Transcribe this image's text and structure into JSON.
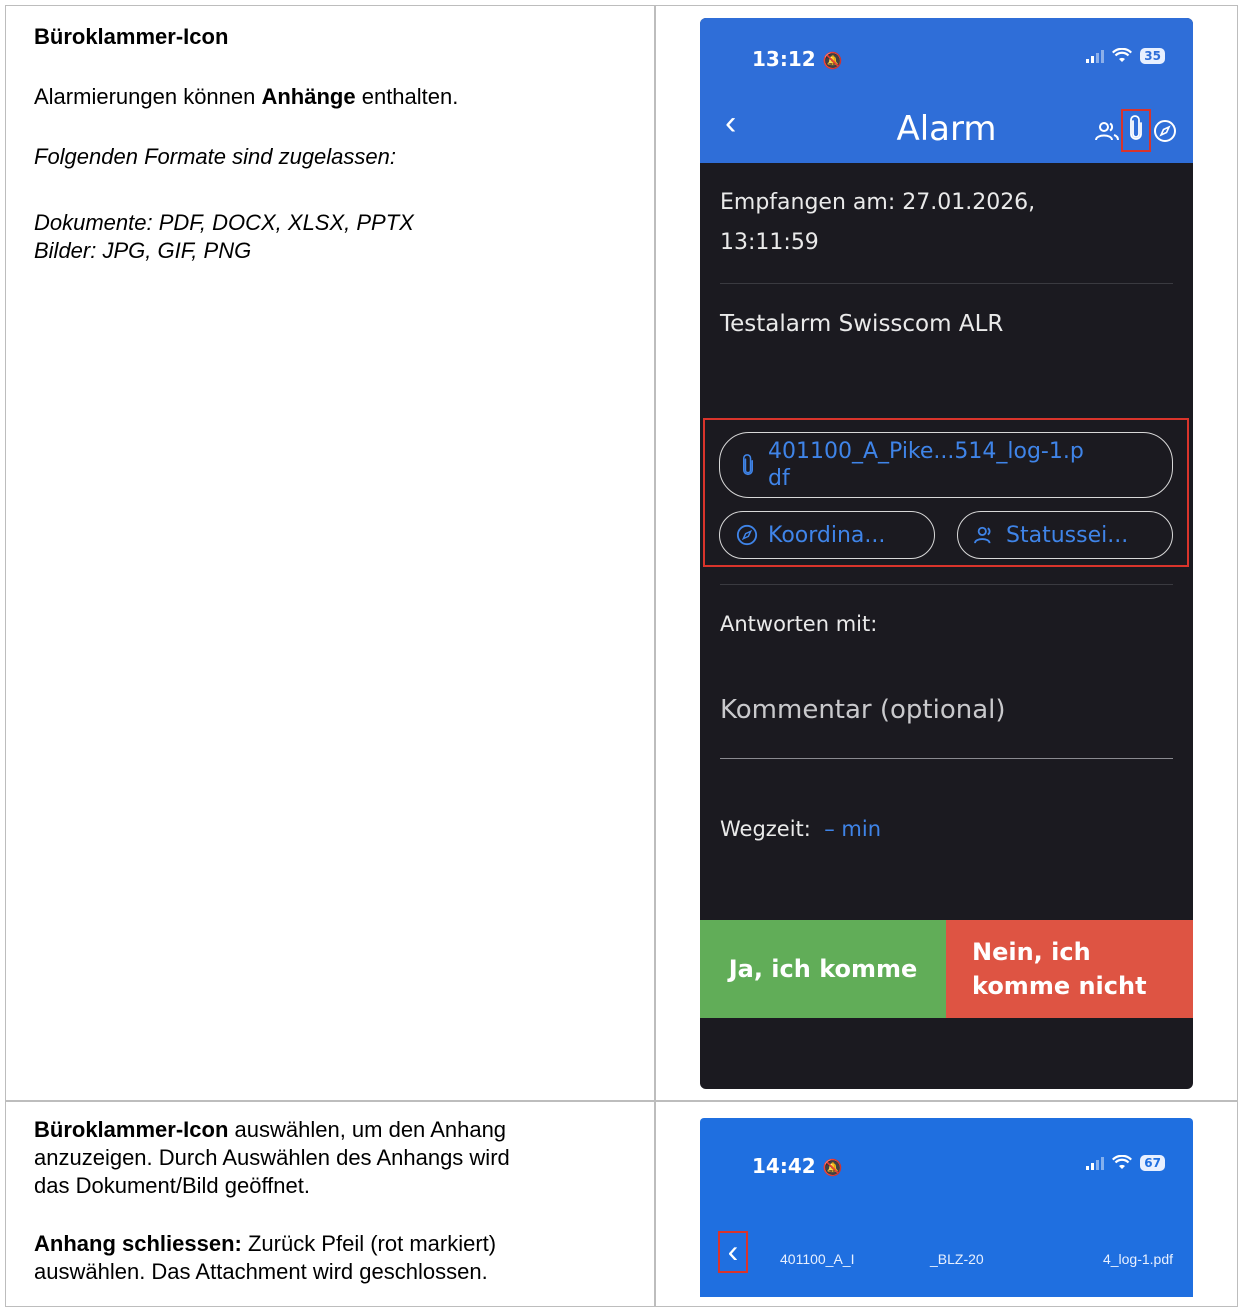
{
  "left_top": {
    "heading": "Büroklammer-Icon",
    "intro_prefix": "Alarmierungen können ",
    "intro_bold": "Anhänge",
    "intro_suffix": " enthalten.",
    "formats_intro": "Folgenden Formate sind zugelassen:",
    "documents": "Dokumente: PDF, DOCX, XLSX, PPTX",
    "images": "Bilder: JPG, GIF, PNG"
  },
  "phone1": {
    "status_time": "13:12",
    "battery": "35",
    "title": "Alarm",
    "received": "Empfangen am: 27.01.2026,",
    "received_time": "13:11:59",
    "message": "Testalarm Swisscom ALR",
    "attachment_line1": "401100_A_Pike...514_log-1.p",
    "attachment_line2": "df",
    "chip_coords": "Koordina...",
    "chip_status": "Statussei...",
    "reply_label": "Antworten mit:",
    "comment_placeholder": "Kommentar (optional)",
    "travel_label": "Wegzeit:",
    "travel_value": "– min",
    "yes_button": "Ja, ich komme",
    "no_button_line1": "Nein, ich",
    "no_button_line2": "komme nicht"
  },
  "left_bottom": {
    "p1_bold": "Büroklammer-Icon",
    "p1_rest_line1": " auswählen, um den Anhang",
    "p1_line2": "anzuzeigen. Durch Auswählen des Anhangs wird",
    "p1_line3": "das Dokument/Bild geöffnet.",
    "p2_bold": "Anhang schliessen:",
    "p2_rest_line1": " Zurück Pfeil (rot markiert)",
    "p2_line2": "auswählen. Das Attachment wird geschlossen."
  },
  "phone2": {
    "status_time": "14:42",
    "battery": "67",
    "file_part1": "401100_A_I",
    "file_part2": "_BLZ-20",
    "file_part3": "4_log-1.pdf"
  },
  "colors": {
    "header_blue": "#2f6ed8",
    "dark_bg": "#1b1a20",
    "link_blue": "#3f84e8",
    "yes_green": "#61ad58",
    "no_red": "#de5443",
    "highlight_red": "#d9342b"
  }
}
